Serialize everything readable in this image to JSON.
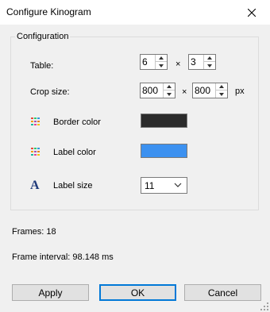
{
  "window": {
    "title": "Configure Kinogram"
  },
  "group": {
    "title": "Configuration"
  },
  "table": {
    "label": "Table:",
    "cols": "6",
    "rows": "3",
    "times": "×"
  },
  "crop": {
    "label": "Crop size:",
    "width": "800",
    "height": "800",
    "times": "×",
    "unit": "px"
  },
  "border_color": {
    "label": "Border color",
    "color": "#2b2b2b"
  },
  "label_color": {
    "label": "Label color",
    "color": "#3c91f0"
  },
  "label_size": {
    "label": "Label size",
    "value": "11",
    "icon_glyph": "A"
  },
  "info": {
    "frames": "Frames: 18",
    "frame_interval": "Frame interval: 98.148 ms"
  },
  "buttons": {
    "apply": "Apply",
    "ok": "OK",
    "cancel": "Cancel"
  },
  "icons": {
    "close": "close-icon",
    "palette": "palette-icon",
    "font": "font-icon",
    "chevron": "chevron-down-icon"
  }
}
